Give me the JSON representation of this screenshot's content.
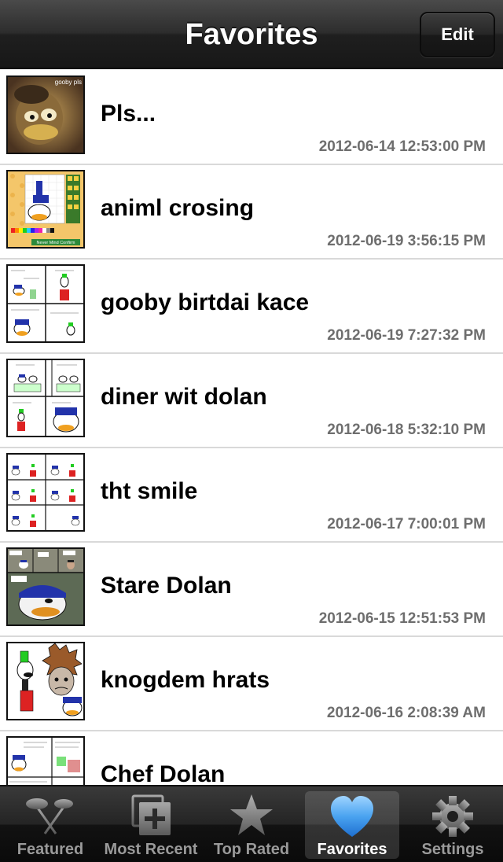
{
  "navbar": {
    "title": "Favorites",
    "edit_label": "Edit"
  },
  "favorites": [
    {
      "title": "Pls...",
      "date": "2012-06-14 12:53:00 PM",
      "thumb_text": "gooby pls"
    },
    {
      "title": "animl crosing",
      "date": "2012-06-19 3:56:15 PM",
      "thumb_text": "Never Mind  Confirm"
    },
    {
      "title": "gooby birtdai kace",
      "date": "2012-06-19 7:27:32 PM"
    },
    {
      "title": "diner wit dolan",
      "date": "2012-06-18 5:32:10 PM"
    },
    {
      "title": "tht smile",
      "date": "2012-06-17 7:00:01 PM"
    },
    {
      "title": "Stare Dolan",
      "date": "2012-06-15 12:51:53 PM"
    },
    {
      "title": "knogdem hrats",
      "date": "2012-06-16 2:08:39 AM"
    },
    {
      "title": "Chef Dolan",
      "date": ""
    }
  ],
  "tabbar": {
    "tabs": [
      {
        "label": "Featured",
        "icon": "featured-icon"
      },
      {
        "label": "Most Recent",
        "icon": "most-recent-icon"
      },
      {
        "label": "Top Rated",
        "icon": "star-icon"
      },
      {
        "label": "Favorites",
        "icon": "heart-icon",
        "active": true
      },
      {
        "label": "Settings",
        "icon": "gear-icon"
      }
    ]
  },
  "colors": {
    "heart": "#4aa3f0",
    "inactive_tab_text": "#9a9a9a",
    "date_text": "#6e6e6e"
  }
}
